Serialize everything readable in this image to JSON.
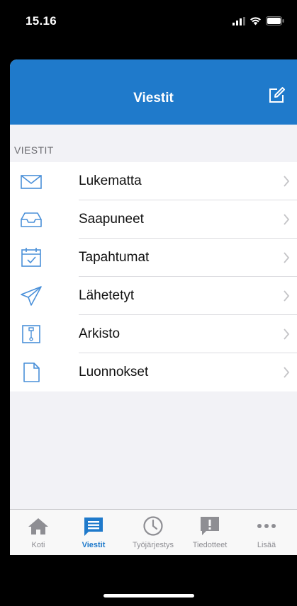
{
  "status_bar": {
    "time": "15.16",
    "icons": [
      "signal-icon",
      "wifi-icon",
      "battery-icon"
    ]
  },
  "navbar": {
    "title": "Viestit",
    "compose_icon": "compose-icon",
    "color": "#1f7acb"
  },
  "section": {
    "header": "VIESTIT"
  },
  "rows": [
    {
      "label": "Lukematta",
      "icon": "envelope-icon"
    },
    {
      "label": "Saapuneet",
      "icon": "inbox-icon"
    },
    {
      "label": "Tapahtumat",
      "icon": "calendar-check-icon"
    },
    {
      "label": "Lähetetyt",
      "icon": "paper-plane-icon"
    },
    {
      "label": "Arkisto",
      "icon": "archive-icon"
    },
    {
      "label": "Luonnokset",
      "icon": "document-icon"
    }
  ],
  "tabbar": {
    "active": "Viestit",
    "tabs": [
      {
        "label": "Koti",
        "icon": "home-icon"
      },
      {
        "label": "Viestit",
        "icon": "messages-icon"
      },
      {
        "label": "Työjärjestys",
        "icon": "clock-icon"
      },
      {
        "label": "Tiedotteet",
        "icon": "announcement-icon"
      },
      {
        "label": "Lisää",
        "icon": "more-icon"
      }
    ]
  },
  "colors": {
    "accent": "#1f7acb",
    "icon_blue": "#4a90d9",
    "inactive": "#8e8e93"
  }
}
